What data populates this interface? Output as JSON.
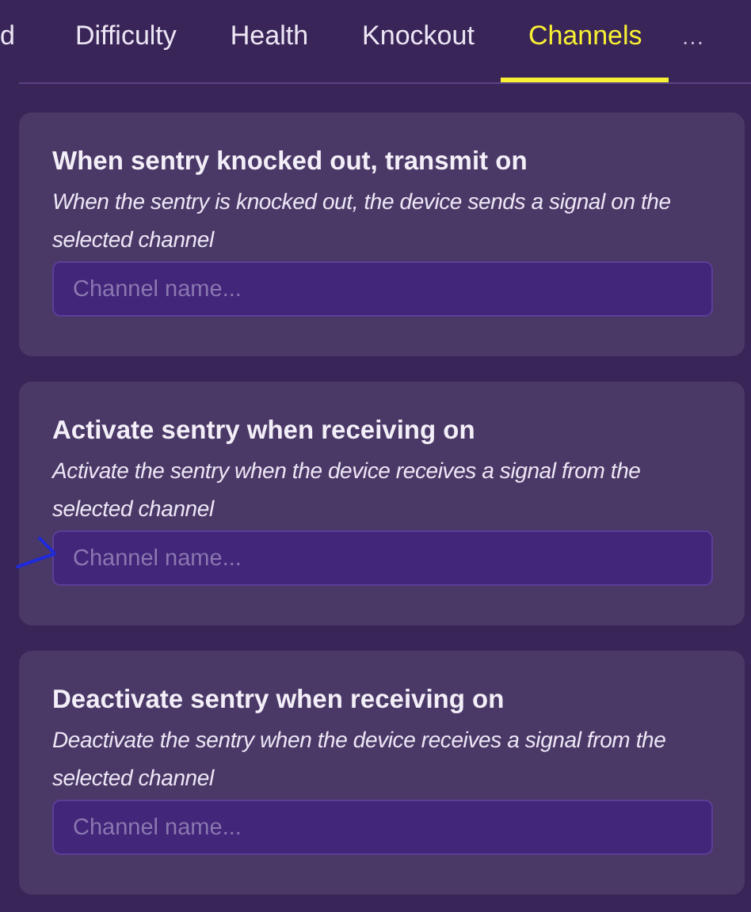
{
  "tabs": [
    {
      "label": "d",
      "selected": false
    },
    {
      "label": "Difficulty",
      "selected": false
    },
    {
      "label": "Health",
      "selected": false
    },
    {
      "label": "Knockout",
      "selected": false
    },
    {
      "label": "Channels",
      "selected": true
    }
  ],
  "more": "···",
  "sections": [
    {
      "title": "When sentry knocked out, transmit on",
      "description": "When the sentry is knocked out, the device sends a signal on the selected channel",
      "placeholder": "Channel name...",
      "annotated": false
    },
    {
      "title": "Activate sentry when receiving on",
      "description": "Activate the sentry when the device receives a signal from the selected channel",
      "placeholder": "Channel name...",
      "annotated": true
    },
    {
      "title": "Deactivate sentry when receiving on",
      "description": "Deactivate the sentry when the device receives a signal from the selected channel",
      "placeholder": "Channel name...",
      "annotated": false
    }
  ]
}
